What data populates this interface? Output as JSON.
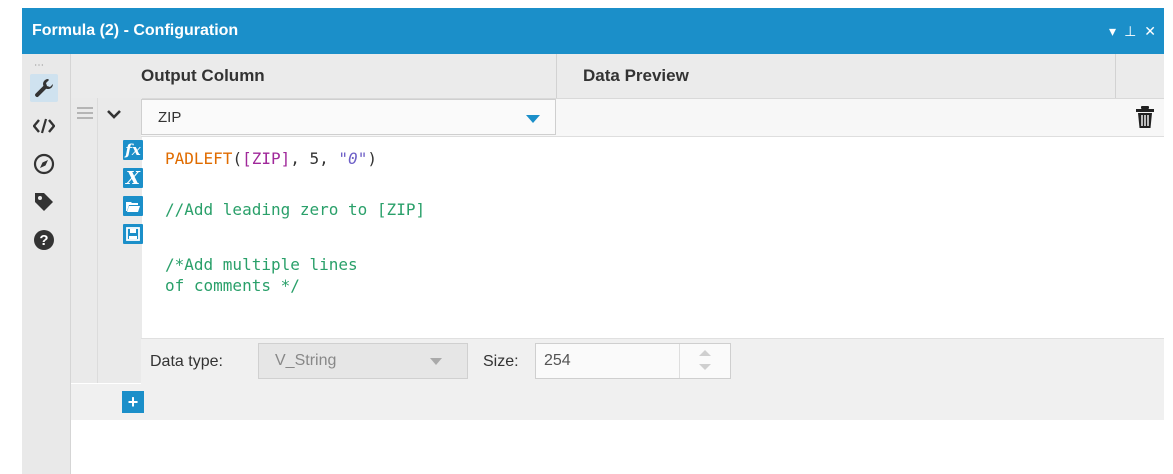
{
  "window": {
    "title": "Formula (2) - Configuration",
    "controls": {
      "menu": "▾",
      "pin": "⊥",
      "close": "✕"
    }
  },
  "sidebar": {
    "handle": "⋯",
    "icons": [
      "wrench-icon",
      "code-icon",
      "compass-icon",
      "tag-icon",
      "help-icon"
    ],
    "active": "wrench-icon"
  },
  "grid": {
    "headers": {
      "output_column": "Output Column",
      "data_preview": "Data Preview"
    }
  },
  "formula": {
    "output_column_value": "ZIP",
    "code": {
      "fn_name": "PADLEFT",
      "open_paren": "(",
      "field": "[ZIP]",
      "comma_num": ", 5, ",
      "string_literal": "\"0\"",
      "close_paren": ")",
      "comment1": "//Add leading zero to [ZIP]",
      "comment2_line1": "/*Add multiple lines",
      "comment2_line2": "of comments */"
    },
    "toolbar_icons": [
      "fx-icon",
      "variable-icon",
      "open-folder-icon",
      "save-icon"
    ],
    "data_type_label": "Data type:",
    "data_type_value": "V_String",
    "size_label": "Size:",
    "size_value": "254"
  },
  "add_button_label": "+",
  "colors": {
    "accent": "#1b8fc9",
    "function": "#e06c00",
    "field": "#a0289a",
    "comment": "#2aa06a",
    "string": "#6d5fc7"
  }
}
